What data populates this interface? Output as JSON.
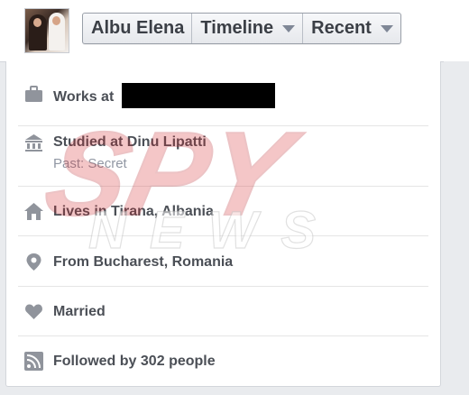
{
  "header": {
    "name_label": "Albu Elena",
    "timeline_label": "Timeline",
    "recent_label": "Recent"
  },
  "about": {
    "works": {
      "prefix": "Works at",
      "icon": "briefcase-icon"
    },
    "studied": {
      "prefix": "Studied at",
      "school": "Dinu Lipatti",
      "sub": "Past: Secret",
      "icon": "school-icon"
    },
    "lives": {
      "prefix": "Lives in",
      "city": "Tirana",
      "sep": ",",
      "country": "Albania",
      "icon": "home-icon"
    },
    "from": {
      "prefix": "From",
      "city": "Bucharest",
      "sep": ",",
      "country": "Romania",
      "icon": "location-pin-icon"
    },
    "relationship": {
      "label": "Married",
      "icon": "heart-icon"
    },
    "followers": {
      "prefix": "Followed by",
      "count": "302",
      "suffix": "people",
      "icon": "rss-icon"
    }
  },
  "watermark": {
    "top": "SPY",
    "bottom": "NEWS"
  },
  "colors": {
    "text": "#4b4f56",
    "icon": "#90949c",
    "sub_text": "#9197a3",
    "watermark_red": "#d7262b"
  }
}
